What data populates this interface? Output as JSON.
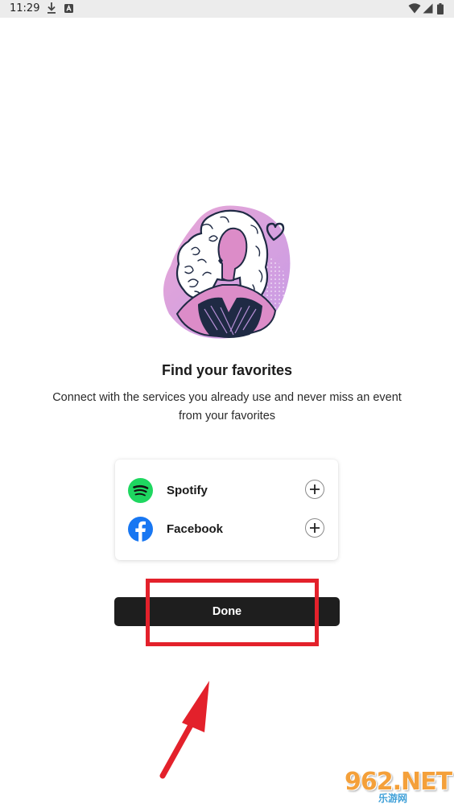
{
  "status_bar": {
    "time": "11:29"
  },
  "heading": "Find your favorites",
  "description": "Connect with the services you already use and never miss an event from your favorites",
  "services": [
    {
      "name": "Spotify",
      "icon": "spotify-logo-icon",
      "color": "#1ED760"
    },
    {
      "name": "Facebook",
      "icon": "facebook-logo-icon",
      "color": "#1877F2"
    }
  ],
  "done_label": "Done",
  "watermark": {
    "big": "962.NET",
    "small": "乐游网"
  },
  "colors": {
    "button_bg": "#1e1e1e",
    "highlight": "#e3212b",
    "accent_pink": "#e9a7d6",
    "accent_purple": "#b993e0"
  }
}
